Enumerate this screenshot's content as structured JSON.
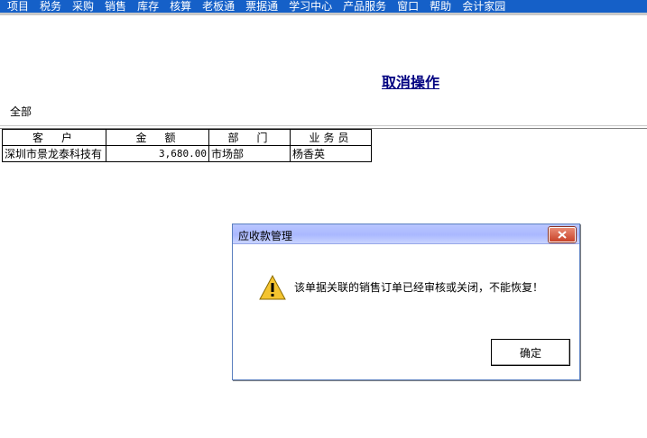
{
  "menu": [
    "项目",
    "税务",
    "采购",
    "销售",
    "库存",
    "核算",
    "老板通",
    "票据通",
    "学习中心",
    "产品服务",
    "窗口",
    "帮助",
    "会计家园"
  ],
  "page": {
    "title": "取消操作",
    "filter_label": "全部"
  },
  "table": {
    "headers": [
      "客　户",
      "金　额",
      "部　门",
      "业务员"
    ],
    "rows": [
      [
        "深圳市景龙泰科技有",
        "3,680.00",
        "市场部",
        "杨香英"
      ]
    ]
  },
  "dialog": {
    "title": "应收款管理",
    "message": "该单据关联的销售订单已经审核或关闭，不能恢复！",
    "ok_label": "确定",
    "close_icon": "close-icon",
    "status_icon": "warning-icon"
  },
  "colors": {
    "menubar": "#1560c8",
    "title": "#000080",
    "dialog_border": "#5a7fbf",
    "close_button": "#c8432a",
    "warning": "#f4c430"
  }
}
